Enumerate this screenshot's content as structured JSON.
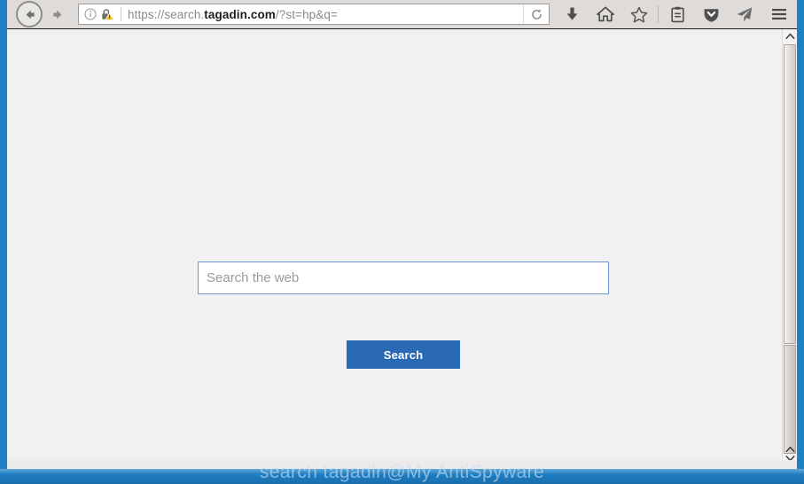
{
  "browser": {
    "back_button": "Back",
    "forward_button": "Forward",
    "url_prefix": "https://search.",
    "url_domain": "tagadin.com",
    "url_suffix": "/?st=hp&q=",
    "url_full": "https://search.tagadin.com/?st=hp&q=",
    "reload_button": "Reload",
    "icons": {
      "info": "info-icon",
      "insecure_lock": "insecure-lock-icon",
      "reload": "reload-icon",
      "downloads": "download-icon",
      "home": "home-icon",
      "bookmark": "star-icon",
      "library": "library-icon",
      "pocket": "pocket-shield-icon",
      "send": "paper-plane-icon",
      "menu": "hamburger-menu-icon"
    }
  },
  "page": {
    "search_placeholder": "Search the web",
    "search_value": "",
    "search_button_label": "Search",
    "watermark": "search tagadin@My AntiSpyware"
  },
  "colors": {
    "accent_blue": "#2a6ab4",
    "input_border": "#6f94c9",
    "page_background": "#f1f1f1",
    "toolbar_background": "#dedbd8",
    "window_frame_blue": "#1f7fc4",
    "warning_yellow": "#f0c419"
  }
}
